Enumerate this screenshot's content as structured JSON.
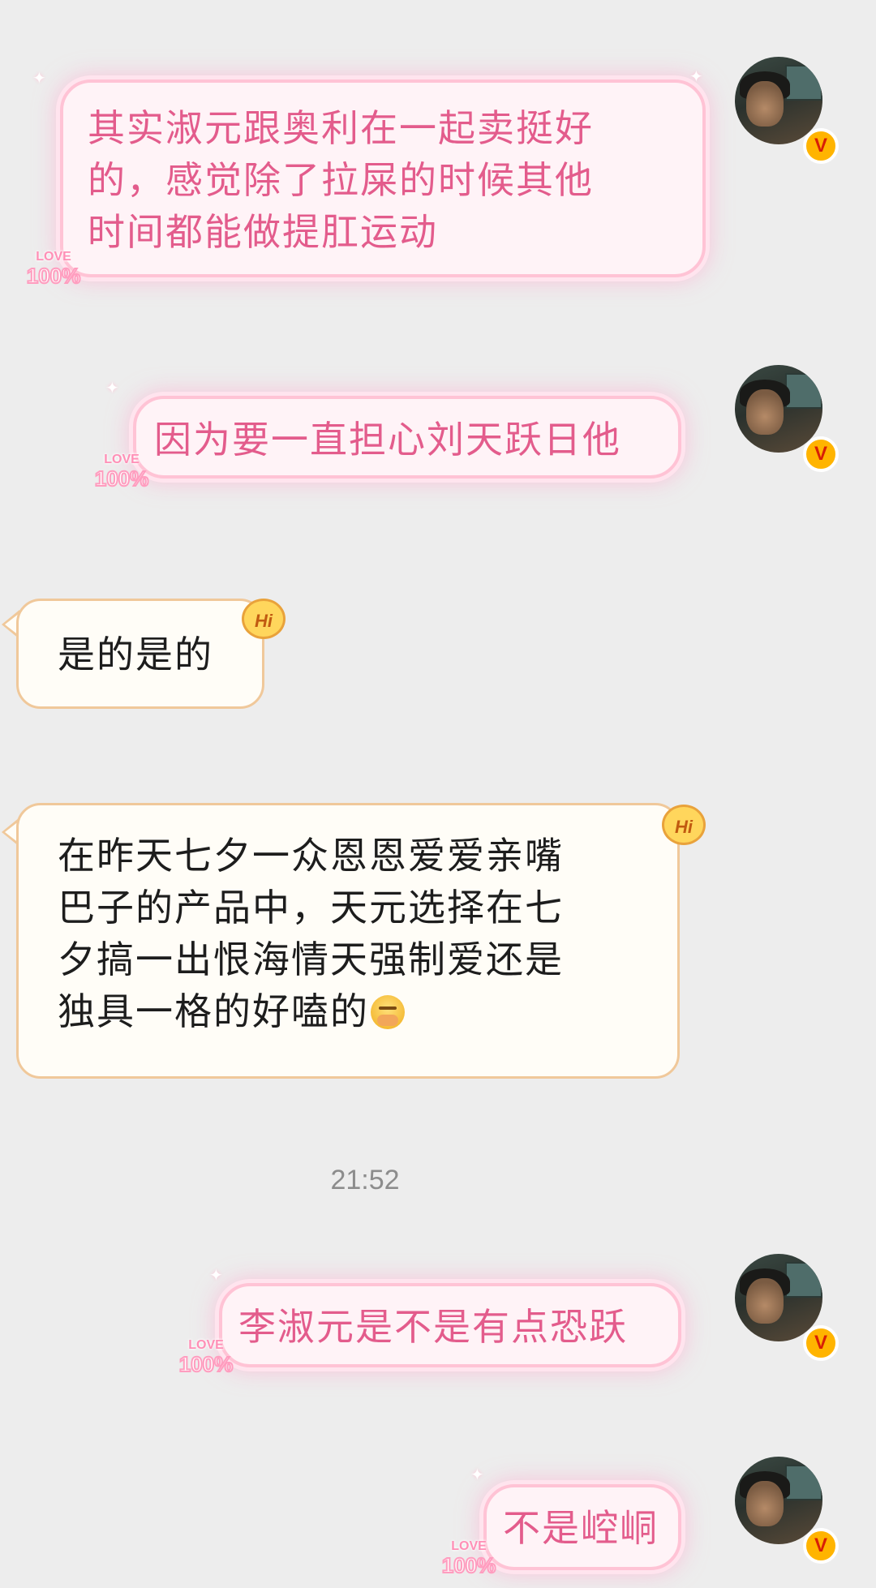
{
  "messages": [
    {
      "side": "outgoing",
      "lines": [
        "其实淑元跟奥利在一起卖挺好",
        "的，感觉除了拉屎的时候其他",
        "时间都能做提肛运动"
      ],
      "bubble_badge": "LOVE 100%"
    },
    {
      "side": "outgoing",
      "lines": [
        "因为要一直担心刘天跃日他"
      ],
      "bubble_badge": "LOVE 100%"
    },
    {
      "side": "incoming",
      "lines": [
        "是的是的"
      ],
      "bubble_badge": "Hi"
    },
    {
      "side": "incoming",
      "lines": [
        "在昨天七夕一众恩恩爱爱亲嘴",
        "巴子的产品中，天元选择在七",
        "夕搞一出恨海情天强制爱还是",
        "独具一格的好嗑的"
      ],
      "emoji": "hand-over-mouth-emoji",
      "bubble_badge": "Hi"
    },
    {
      "side": "outgoing",
      "lines": [
        "李淑元是不是有点恐跃"
      ],
      "bubble_badge": "LOVE 100%"
    },
    {
      "side": "outgoing",
      "lines": [
        "不是崆峒"
      ],
      "bubble_badge": "LOVE 100%"
    }
  ],
  "timestamp": "21:52",
  "badges": {
    "love_top": "LOVE",
    "love_bottom": "100%",
    "hi": "Hi",
    "verified": "V"
  },
  "colors": {
    "background": "#ededed",
    "outgoing_text": "#e35c8c",
    "incoming_border": "#f0c89a"
  }
}
